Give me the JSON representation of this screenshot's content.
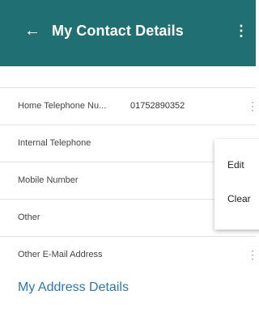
{
  "header": {
    "title": "My Contact Details",
    "back_icon": "←",
    "menu_icon": "⋮",
    "background_color": "#1f6f73"
  },
  "rows": [
    {
      "label": "Home Telephone Nu...",
      "value": "01752890352",
      "has_menu": true
    },
    {
      "label": "Internal Telephone",
      "value": "",
      "has_menu": false
    },
    {
      "label": "Mobile Number",
      "value": "",
      "has_menu": false
    },
    {
      "label": "Other",
      "value": "",
      "has_menu": false
    },
    {
      "label": "Other E-Mail Address",
      "value": "",
      "has_menu": true
    }
  ],
  "row_menu_icon": "⋮",
  "section": {
    "title": "My Address Details",
    "color": "#2a78b5"
  },
  "context_menu": {
    "items": [
      "Edit",
      "Clear"
    ]
  }
}
